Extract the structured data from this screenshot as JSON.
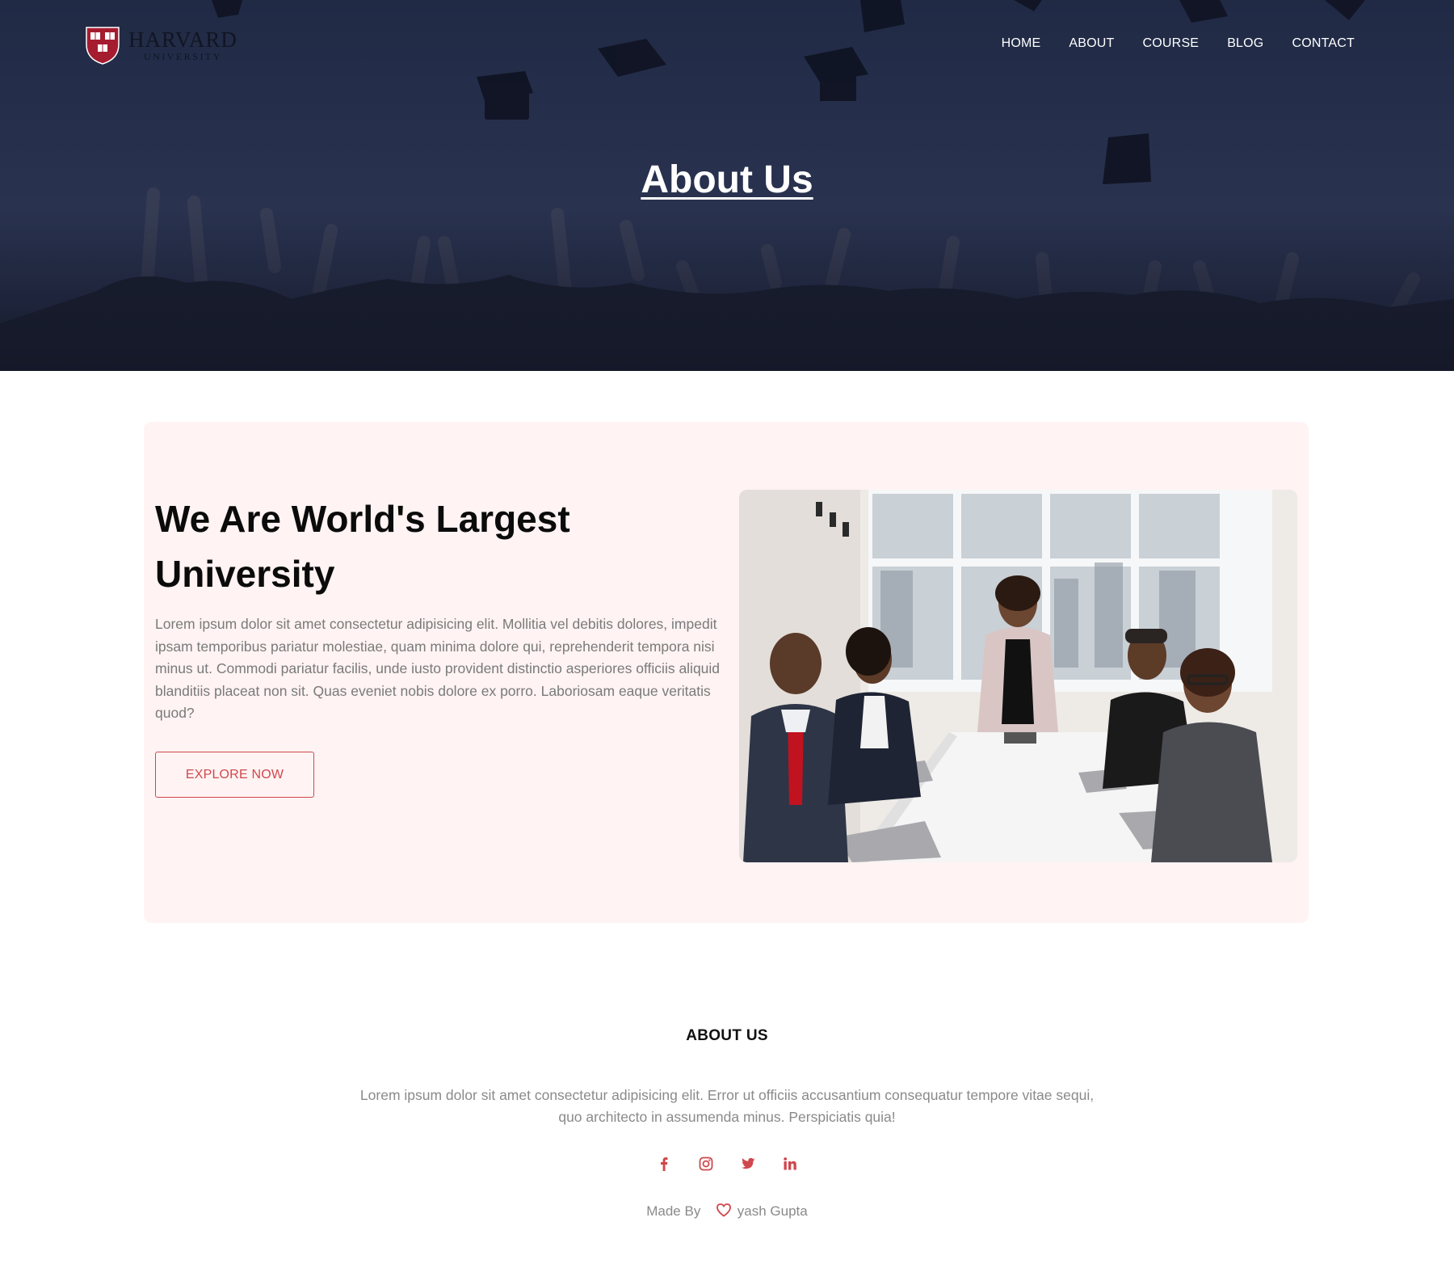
{
  "brand": {
    "name": "HARVARD",
    "subtitle": "UNIVERSITY",
    "accent_color": "#d0474c",
    "shield_color": "#a51c30"
  },
  "nav": {
    "items": [
      {
        "label": "HOME"
      },
      {
        "label": "ABOUT"
      },
      {
        "label": "COURSE"
      },
      {
        "label": "BLOG"
      },
      {
        "label": "CONTACT"
      }
    ]
  },
  "hero": {
    "title": "About Us"
  },
  "about": {
    "heading": "We Are World's Largest University",
    "text": "Lorem ipsum dolor sit amet consectetur adipisicing elit. Mollitia vel debitis dolores, impedit ipsam temporibus pariatur molestiae, quam minima dolore qui, reprehenderit tempora nisi minus ut. Commodi pariatur facilis, unde iusto provident distinctio asperiores officiis aliquid blanditiis placeat non sit. Quas eveniet nobis dolore ex porro. Laboriosam eaque veritatis quod?",
    "button_label": "EXPLORE NOW",
    "card_color": "#fff3f3"
  },
  "footer": {
    "title": "ABOUT US",
    "text": "Lorem ipsum dolor sit amet consectetur adipisicing elit. Error ut officiis accusantium consequatur tempore vitae sequi, quo architecto in assumenda minus. Perspiciatis quia!",
    "socials": [
      {
        "icon": "facebook-icon"
      },
      {
        "icon": "instagram-icon"
      },
      {
        "icon": "twitter-icon"
      },
      {
        "icon": "linkedin-icon"
      }
    ],
    "made_by_label": "Made By",
    "author": "yash Gupta"
  }
}
